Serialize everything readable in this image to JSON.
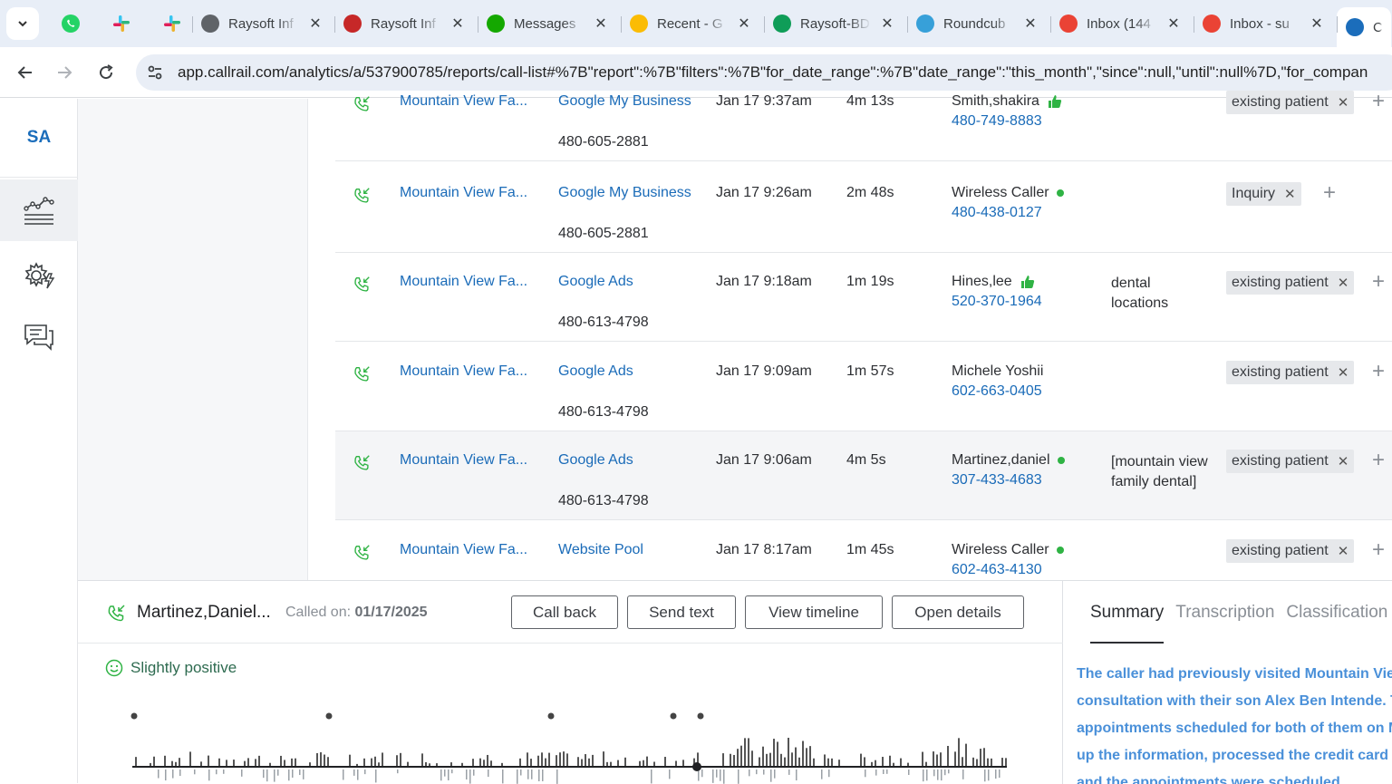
{
  "browser": {
    "tabs": [
      {
        "title": "Raysoft Inf",
        "icon": "globe-icon",
        "color": "#5f6368"
      },
      {
        "title": "Raysoft Inf",
        "icon": "raysoft-icon",
        "color": "#c62828"
      },
      {
        "title": "Messages",
        "icon": "upwork-icon",
        "color": "#14a800"
      },
      {
        "title": "Recent - G",
        "icon": "google-drive-icon",
        "color": "#fbbc04"
      },
      {
        "title": "Raysoft-BD",
        "icon": "google-sheets-icon",
        "color": "#0f9d58"
      },
      {
        "title": "Roundcub",
        "icon": "roundcube-icon",
        "color": "#37a0d9"
      },
      {
        "title": "Inbox (144",
        "icon": "gmail-icon",
        "color": "#ea4335"
      },
      {
        "title": "Inbox - su",
        "icon": "gmail-icon",
        "color": "#ea4335"
      },
      {
        "title": "C",
        "icon": "callrail-icon",
        "color": "#1b6dbb"
      }
    ],
    "url": "app.callrail.com/analytics/a/537900785/reports/call-list#%7B\"report\":%7B\"filters\":%7B\"for_date_range\":%7B\"date_range\":\"this_month\",\"since\":null,\"until\":null%7D,\"for_compan"
  },
  "app": {
    "account_initials": "SA"
  },
  "calls": [
    {
      "company": "Mountain View Fa...",
      "source": "Google My Business",
      "tracking": "480-605-2881",
      "date": "Jan 17 9:37am",
      "duration": "4m 13s",
      "caller": "Smith,shakira",
      "caller_marker": "thumb",
      "phone": "480-749-8883",
      "keywords": "",
      "tag": "existing patient"
    },
    {
      "company": "Mountain View Fa...",
      "source": "Google My Business",
      "tracking": "480-605-2881",
      "date": "Jan 17 9:26am",
      "duration": "2m 48s",
      "caller": "Wireless Caller",
      "caller_marker": "dot",
      "phone": "480-438-0127",
      "keywords": "",
      "tag": "Inquiry"
    },
    {
      "company": "Mountain View Fa...",
      "source": "Google Ads",
      "tracking": "480-613-4798",
      "date": "Jan 17 9:18am",
      "duration": "1m 19s",
      "caller": "Hines,lee",
      "caller_marker": "thumb",
      "phone": "520-370-1964",
      "keywords": "dental locations",
      "tag": "existing patient"
    },
    {
      "company": "Mountain View Fa...",
      "source": "Google Ads",
      "tracking": "480-613-4798",
      "date": "Jan 17 9:09am",
      "duration": "1m 57s",
      "caller": "Michele Yoshii",
      "caller_marker": "",
      "phone": "602-663-0405",
      "keywords": "",
      "tag": "existing patient"
    },
    {
      "company": "Mountain View Fa...",
      "source": "Google Ads",
      "tracking": "480-613-4798",
      "date": "Jan 17 9:06am",
      "duration": "4m 5s",
      "caller": "Martinez,daniel",
      "caller_marker": "dot",
      "phone": "307-433-4683",
      "keywords": "[mountain view family dental]",
      "tag": "existing patient"
    },
    {
      "company": "Mountain View Fa...",
      "source": "Website Pool",
      "tracking": "",
      "date": "Jan 17 8:17am",
      "duration": "1m 45s",
      "caller": "Wireless Caller",
      "caller_marker": "dot",
      "phone": "602-463-4130",
      "keywords": "",
      "tag": "existing patient"
    }
  ],
  "detail": {
    "name": "Martinez,Daniel...",
    "called_on_label": "Called on:",
    "called_on_date": "01/17/2025",
    "buttons": {
      "call_back": "Call back",
      "send_text": "Send text",
      "view_timeline": "View timeline",
      "open_details": "Open details"
    },
    "sentiment": "Slightly positive",
    "tabs": [
      "Summary",
      "Transcription",
      "Classification"
    ],
    "summary_lines": [
      "The caller had previously visited Mountain View",
      "consultation with their son Alex Ben Intende. T",
      "appointments scheduled for both of them on M",
      "up the information, processed the credit card p",
      "and the appointments were scheduled."
    ]
  },
  "colors": {
    "link": "#1a6bb8",
    "sentiment_green": "#2e6b50",
    "summary_blue": "#4a90d9",
    "status_dot": "#2fb344"
  }
}
